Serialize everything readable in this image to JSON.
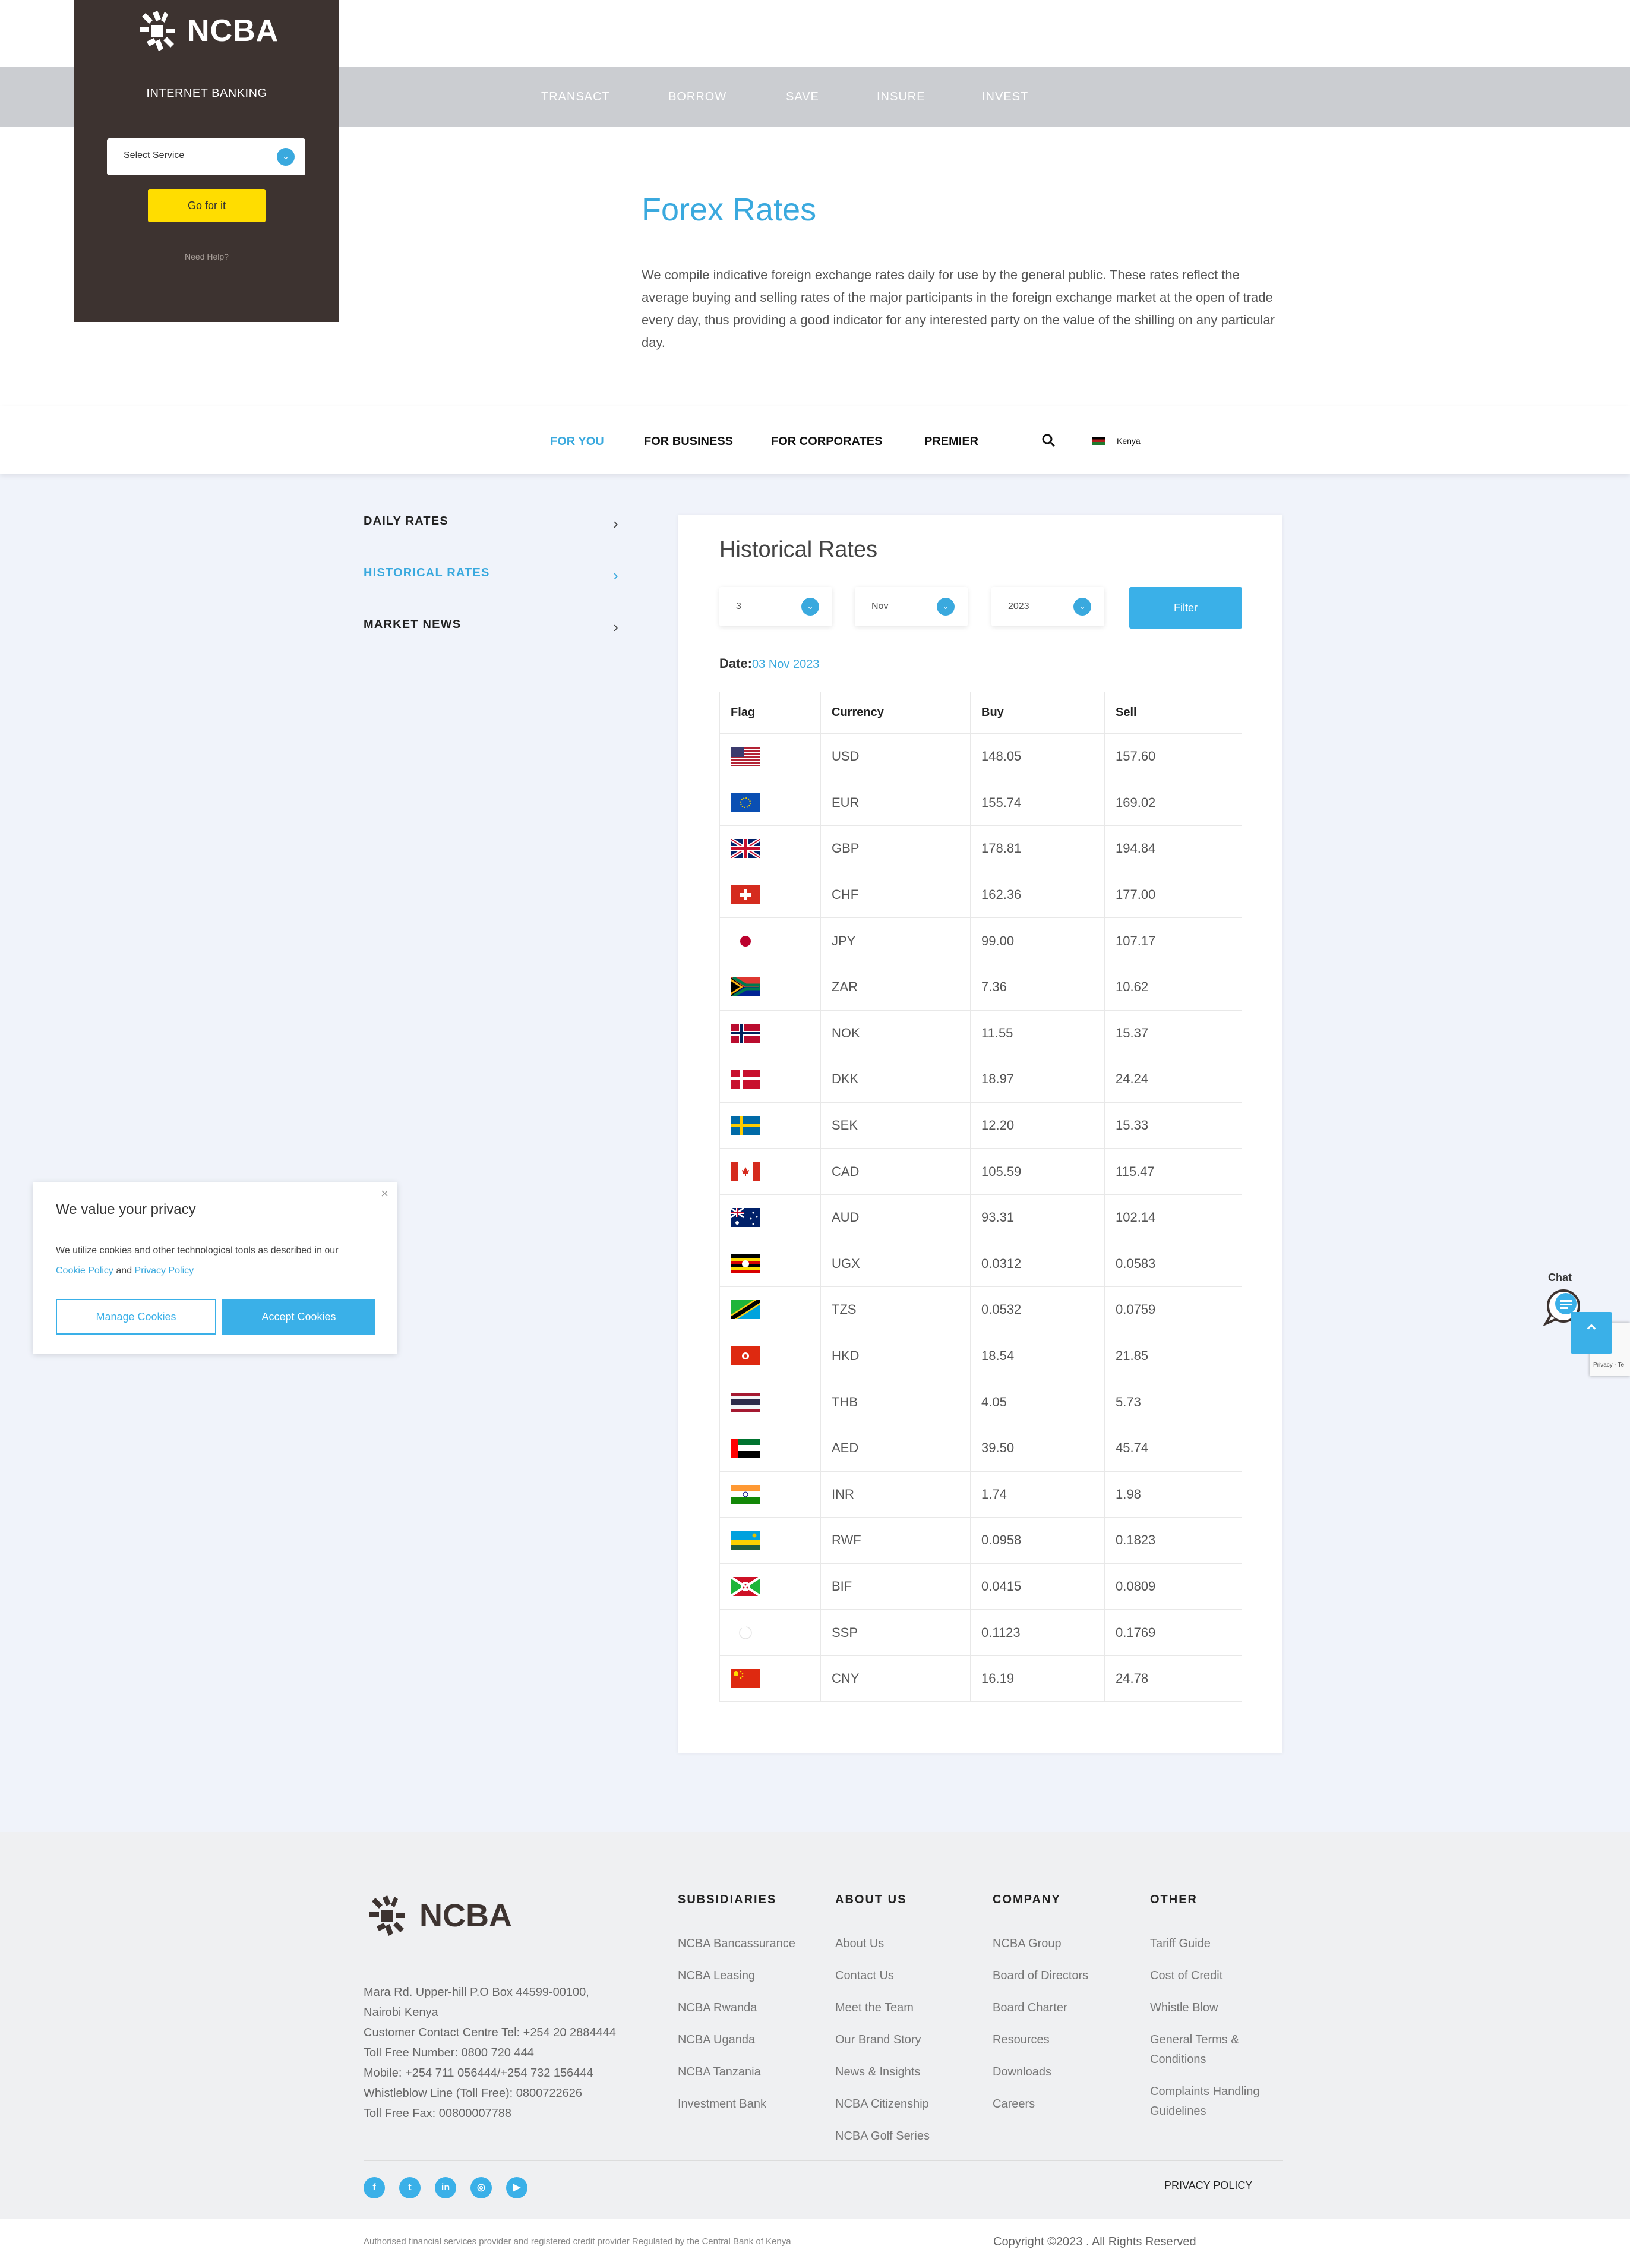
{
  "brand": {
    "name": "NCBA"
  },
  "login": {
    "label": "INTERNET BANKING",
    "select_placeholder": "Select Service",
    "go_label": "Go for it",
    "help": "Need Help?"
  },
  "top_nav": [
    "TRANSACT",
    "BORROW",
    "SAVE",
    "INSURE",
    "INVEST"
  ],
  "hero": {
    "title": "Forex Rates",
    "description": "We compile indicative foreign exchange rates daily for use by the general public. These rates reflect the average buying and selling rates of the major participants in the foreign exchange market at the open of trade every day, thus providing a good indicator for any interested party on the value of the shilling on any particular day."
  },
  "sec_nav": {
    "links": [
      "FOR YOU",
      "FOR BUSINESS",
      "FOR CORPORATES",
      "PREMIER"
    ],
    "country": "Kenya"
  },
  "side_menu": [
    "DAILY RATES",
    "HISTORICAL RATES",
    "MARKET NEWS"
  ],
  "card": {
    "title": "Historical Rates",
    "filters": {
      "day": "3",
      "month": "Nov",
      "year": "2023",
      "button": "Filter"
    },
    "date_label": "Date:",
    "date_value": "03 Nov 2023",
    "headers": [
      "Flag",
      "Currency",
      "Buy",
      "Sell"
    ],
    "rows": [
      {
        "code": "USD",
        "buy": "148.05",
        "sell": "157.60"
      },
      {
        "code": "EUR",
        "buy": "155.74",
        "sell": "169.02"
      },
      {
        "code": "GBP",
        "buy": "178.81",
        "sell": "194.84"
      },
      {
        "code": "CHF",
        "buy": "162.36",
        "sell": "177.00"
      },
      {
        "code": "JPY",
        "buy": "99.00",
        "sell": "107.17"
      },
      {
        "code": "ZAR",
        "buy": "7.36",
        "sell": "10.62"
      },
      {
        "code": "NOK",
        "buy": "11.55",
        "sell": "15.37"
      },
      {
        "code": "DKK",
        "buy": "18.97",
        "sell": "24.24"
      },
      {
        "code": "SEK",
        "buy": "12.20",
        "sell": "15.33"
      },
      {
        "code": "CAD",
        "buy": "105.59",
        "sell": "115.47"
      },
      {
        "code": "AUD",
        "buy": "93.31",
        "sell": "102.14"
      },
      {
        "code": "UGX",
        "buy": "0.0312",
        "sell": "0.0583"
      },
      {
        "code": "TZS",
        "buy": "0.0532",
        "sell": "0.0759"
      },
      {
        "code": "HKD",
        "buy": "18.54",
        "sell": "21.85"
      },
      {
        "code": "THB",
        "buy": "4.05",
        "sell": "5.73"
      },
      {
        "code": "AED",
        "buy": "39.50",
        "sell": "45.74"
      },
      {
        "code": "INR",
        "buy": "1.74",
        "sell": "1.98"
      },
      {
        "code": "RWF",
        "buy": "0.0958",
        "sell": "0.1823"
      },
      {
        "code": "BIF",
        "buy": "0.0415",
        "sell": "0.0809"
      },
      {
        "code": "SSP",
        "buy": "0.1123",
        "sell": "0.1769"
      },
      {
        "code": "CNY",
        "buy": "16.19",
        "sell": "24.78"
      }
    ]
  },
  "cookie": {
    "title": "We value your privacy",
    "text_before": "We utilize cookies and other technological tools as described in our",
    "cookie_policy": "Cookie Policy",
    "and": "and",
    "privacy_policy": "Privacy Policy",
    "manage": "Manage Cookies",
    "accept": "Accept Cookies"
  },
  "chat": {
    "label": "Chat"
  },
  "recaptcha": {
    "text": "Privacy - Te"
  },
  "footer": {
    "address_lines": [
      "Mara Rd. Upper-hill P.O Box 44599-00100,",
      "Nairobi Kenya",
      "Customer Contact Centre Tel: +254 20 2884444",
      "Toll Free Number: 0800 720 444",
      "Mobile: +254 711 056444/+254 732 156444",
      "Whistleblow Line (Toll Free): 0800722626",
      "Toll Free Fax: 00800007788"
    ],
    "columns": [
      {
        "title": "SUBSIDIARIES",
        "links": [
          "NCBA Bancassurance",
          "NCBA Leasing",
          "NCBA Rwanda",
          "NCBA Uganda",
          "NCBA Tanzania",
          "Investment Bank"
        ]
      },
      {
        "title": "ABOUT US",
        "links": [
          "About Us",
          "Contact Us",
          "Meet the Team",
          "Our Brand Story",
          "News & Insights",
          "NCBA Citizenship",
          "NCBA Golf Series"
        ]
      },
      {
        "title": "COMPANY",
        "links": [
          "NCBA Group",
          "Board of Directors",
          "Board Charter",
          "Resources",
          "Downloads",
          "Careers"
        ]
      },
      {
        "title": "OTHER",
        "links": [
          "Tariff Guide",
          "Cost of Credit",
          "Whistle Blow",
          "General Terms & Conditions",
          "Complaints Handling Guidelines"
        ]
      }
    ],
    "social": [
      "facebook-icon",
      "twitter-icon",
      "linkedin-icon",
      "instagram-icon",
      "youtube-icon"
    ],
    "privacy": "PRIVACY POLICY",
    "authorised": "Authorised financial services provider and registered credit provider Regulated by the Central Bank of Kenya",
    "copyright": "Copyright ©2023 . All Rights Reserved"
  },
  "colors": {
    "accent": "#3aa9de",
    "brand_dark": "#3d3330",
    "cta_yellow": "#ffdd00"
  }
}
